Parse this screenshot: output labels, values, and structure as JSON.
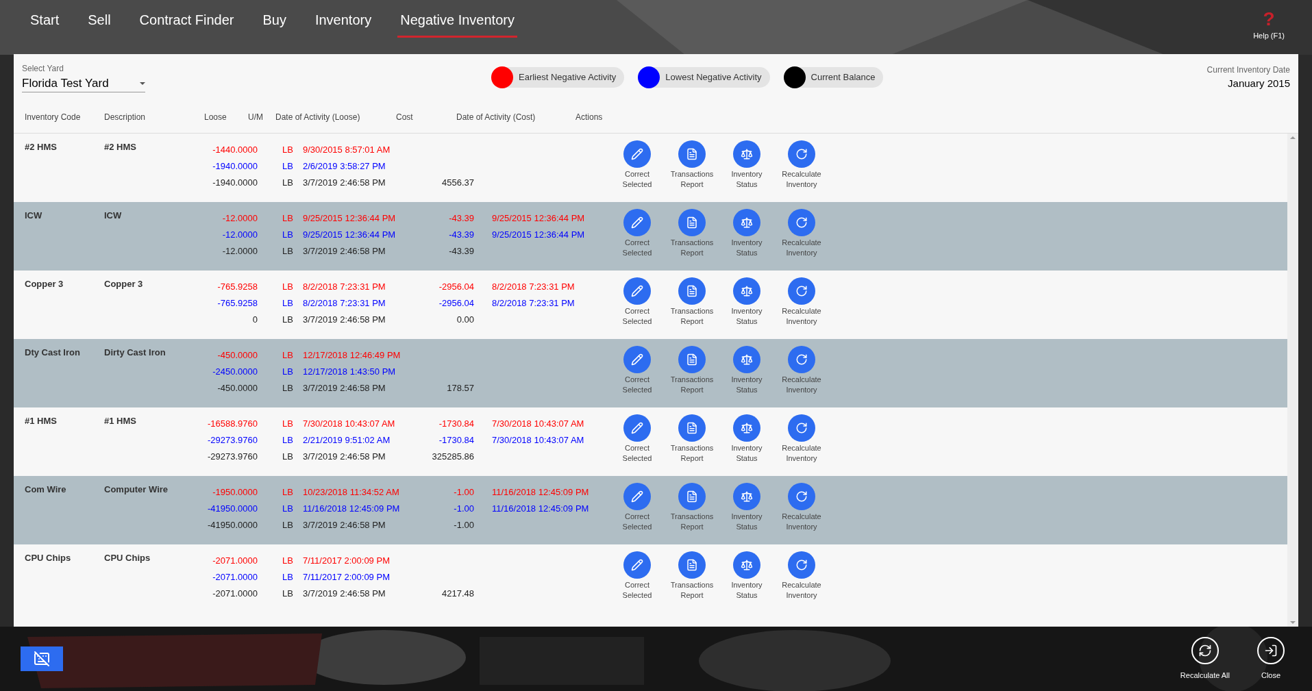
{
  "nav": [
    {
      "label": "Start",
      "selected": false
    },
    {
      "label": "Sell",
      "selected": false
    },
    {
      "label": "Contract Finder",
      "selected": false
    },
    {
      "label": "Buy",
      "selected": false
    },
    {
      "label": "Inventory",
      "selected": false
    },
    {
      "label": "Negative Inventory",
      "selected": true
    }
  ],
  "help": {
    "icon": "?",
    "label": "Help (F1)"
  },
  "yard": {
    "label": "Select Yard",
    "value": "Florida Test Yard"
  },
  "legend": [
    {
      "label": "Earliest Negative Activity",
      "color": "#ff0000"
    },
    {
      "label": "Lowest Negative Activity",
      "color": "#0000ff"
    },
    {
      "label": "Current Balance",
      "color": "#000000"
    }
  ],
  "inventory_date": {
    "label": "Current Inventory Date",
    "value": "January 2015"
  },
  "columns": [
    "Inventory Code",
    "Description",
    "Loose",
    "U/M",
    "Date of Activity (Loose)",
    "Cost",
    "Date of Activity (Cost)",
    "Actions"
  ],
  "rows": [
    {
      "code": "#2 HMS",
      "description": "#2 HMS",
      "lines": [
        {
          "kind": "earliest",
          "loose": "-1440.0000",
          "um": "LB",
          "date_loose": "9/30/2015 8:57:01 AM"
        },
        {
          "kind": "lowest",
          "loose": "-1940.0000",
          "um": "LB",
          "date_loose": "2/6/2019 3:58:27 PM"
        },
        {
          "kind": "current",
          "loose": "-1940.0000",
          "um": "LB",
          "date_loose": "3/7/2019 2:46:58 PM",
          "cost": "4556.37"
        }
      ],
      "actions": [
        {
          "kind": "correct",
          "label": "Correct Selected"
        },
        {
          "kind": "report",
          "label": "Transactions Report"
        },
        {
          "kind": "status",
          "label": "Inventory Status"
        },
        {
          "kind": "recalc",
          "label": "Recalculate Inventory"
        }
      ]
    },
    {
      "code": "ICW",
      "description": "ICW",
      "lines": [
        {
          "kind": "earliest",
          "loose": "-12.0000",
          "um": "LB",
          "date_loose": "9/25/2015 12:36:44 PM",
          "cost": "-43.39",
          "date_cost": "9/25/2015 12:36:44 PM"
        },
        {
          "kind": "lowest",
          "loose": "-12.0000",
          "um": "LB",
          "date_loose": "9/25/2015 12:36:44 PM",
          "cost": "-43.39",
          "date_cost": "9/25/2015 12:36:44 PM"
        },
        {
          "kind": "current",
          "loose": "-12.0000",
          "um": "LB",
          "date_loose": "3/7/2019 2:46:58 PM",
          "cost": "-43.39"
        }
      ],
      "actions": [
        {
          "kind": "correct",
          "label": "Correct Selected"
        },
        {
          "kind": "report",
          "label": "Transactions Report"
        },
        {
          "kind": "status",
          "label": "Inventory Status"
        },
        {
          "kind": "recalc",
          "label": "Recalculate Inventory"
        }
      ]
    },
    {
      "code": "Copper 3",
      "description": "Copper 3",
      "lines": [
        {
          "kind": "earliest",
          "loose": "-765.9258",
          "um": "LB",
          "date_loose": "8/2/2018 7:23:31 PM",
          "cost": "-2956.04",
          "date_cost": "8/2/2018 7:23:31 PM"
        },
        {
          "kind": "lowest",
          "loose": "-765.9258",
          "um": "LB",
          "date_loose": "8/2/2018 7:23:31 PM",
          "cost": "-2956.04",
          "date_cost": "8/2/2018 7:23:31 PM"
        },
        {
          "kind": "current",
          "loose": "0",
          "um": "LB",
          "date_loose": "3/7/2019 2:46:58 PM",
          "cost": "0.00"
        }
      ],
      "actions": [
        {
          "kind": "correct",
          "label": "Correct Selected"
        },
        {
          "kind": "report",
          "label": "Transactions Report"
        },
        {
          "kind": "status",
          "label": "Inventory Status"
        },
        {
          "kind": "recalc",
          "label": "Recalculate Inventory"
        }
      ]
    },
    {
      "code": "Dty Cast Iron",
      "description": "Dirty Cast Iron",
      "lines": [
        {
          "kind": "earliest",
          "loose": "-450.0000",
          "um": "LB",
          "date_loose": "12/17/2018 12:46:49 PM"
        },
        {
          "kind": "lowest",
          "loose": "-2450.0000",
          "um": "LB",
          "date_loose": "12/17/2018 1:43:50 PM"
        },
        {
          "kind": "current",
          "loose": "-450.0000",
          "um": "LB",
          "date_loose": "3/7/2019 2:46:58 PM",
          "cost": "178.57"
        }
      ],
      "actions": [
        {
          "kind": "correct",
          "label": "Correct Selected"
        },
        {
          "kind": "report",
          "label": "Transactions Report"
        },
        {
          "kind": "status",
          "label": "Inventory Status"
        },
        {
          "kind": "recalc",
          "label": "Recalculate Inventory"
        }
      ]
    },
    {
      "code": "#1 HMS",
      "description": "#1 HMS",
      "lines": [
        {
          "kind": "earliest",
          "loose": "-16588.9760",
          "um": "LB",
          "date_loose": "7/30/2018 10:43:07 AM",
          "cost": "-1730.84",
          "date_cost": "7/30/2018 10:43:07 AM"
        },
        {
          "kind": "lowest",
          "loose": "-29273.9760",
          "um": "LB",
          "date_loose": "2/21/2019 9:51:02 AM",
          "cost": "-1730.84",
          "date_cost": "7/30/2018 10:43:07 AM"
        },
        {
          "kind": "current",
          "loose": "-29273.9760",
          "um": "LB",
          "date_loose": "3/7/2019 2:46:58 PM",
          "cost": "325285.86"
        }
      ],
      "actions": [
        {
          "kind": "correct",
          "label": "Correct Selected"
        },
        {
          "kind": "report",
          "label": "Transactions Report"
        },
        {
          "kind": "status",
          "label": "Inventory Status"
        },
        {
          "kind": "recalc",
          "label": "Recalculate Inventory"
        }
      ]
    },
    {
      "code": "Com Wire",
      "description": "Computer Wire",
      "lines": [
        {
          "kind": "earliest",
          "loose": "-1950.0000",
          "um": "LB",
          "date_loose": "10/23/2018 11:34:52 AM",
          "cost": "-1.00",
          "date_cost": "11/16/2018 12:45:09 PM"
        },
        {
          "kind": "lowest",
          "loose": "-41950.0000",
          "um": "LB",
          "date_loose": "11/16/2018 12:45:09 PM",
          "cost": "-1.00",
          "date_cost": "11/16/2018 12:45:09 PM"
        },
        {
          "kind": "current",
          "loose": "-41950.0000",
          "um": "LB",
          "date_loose": "3/7/2019 2:46:58 PM",
          "cost": "-1.00"
        }
      ],
      "actions": [
        {
          "kind": "correct",
          "label": "Correct Selected"
        },
        {
          "kind": "report",
          "label": "Transactions Report"
        },
        {
          "kind": "status",
          "label": "Inventory Status"
        },
        {
          "kind": "recalc",
          "label": "Recalculate Inventory"
        }
      ]
    },
    {
      "code": "CPU Chips",
      "description": "CPU Chips",
      "lines": [
        {
          "kind": "earliest",
          "loose": "-2071.0000",
          "um": "LB",
          "date_loose": "7/11/2017 2:00:09 PM"
        },
        {
          "kind": "lowest",
          "loose": "-2071.0000",
          "um": "LB",
          "date_loose": "7/11/2017 2:00:09 PM"
        },
        {
          "kind": "current",
          "loose": "-2071.0000",
          "um": "LB",
          "date_loose": "3/7/2019 2:46:58 PM",
          "cost": "4217.48"
        }
      ],
      "actions": [
        {
          "kind": "correct",
          "label": "Correct Selected"
        },
        {
          "kind": "report",
          "label": "Transactions Report"
        },
        {
          "kind": "status",
          "label": "Inventory Status"
        },
        {
          "kind": "recalc",
          "label": "Recalculate Inventory"
        }
      ]
    }
  ],
  "footer_buttons": [
    {
      "kind": "recalc",
      "label": "Recalculate All"
    },
    {
      "kind": "close",
      "label": "Close"
    }
  ]
}
